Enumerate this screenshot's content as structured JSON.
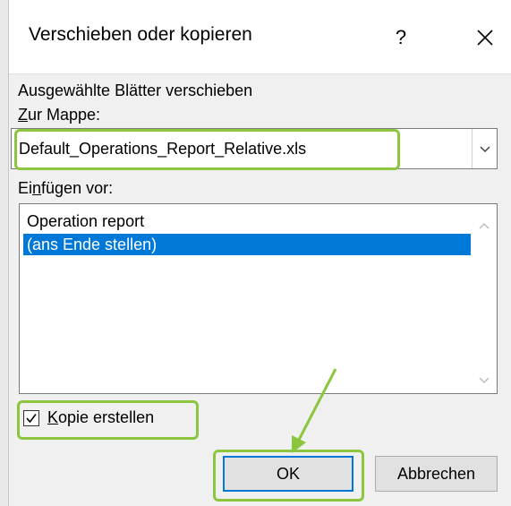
{
  "dialog": {
    "title": "Verschieben oder kopieren",
    "help_label": "?",
    "close_icon": "close-icon"
  },
  "move_section": {
    "heading": "Ausgewählte Blätter verschieben",
    "to_book_label_underlined": "Z",
    "to_book_label_rest": "ur Mappe:",
    "combo_value": "Default_Operations_Report_Relative.xls"
  },
  "insert_before": {
    "label_pre": "Ei",
    "label_underlined": "n",
    "label_post": "fügen vor:",
    "items": [
      {
        "label": "Operation report",
        "selected": false
      },
      {
        "label": "(ans Ende stellen)",
        "selected": true
      }
    ]
  },
  "copy_option": {
    "checked": true,
    "label_underlined": "K",
    "label_rest": "opie erstellen"
  },
  "buttons": {
    "ok_label": "OK",
    "cancel_label": "Abbrechen"
  },
  "colors": {
    "highlight": "#8cc63e",
    "selection": "#0078d7",
    "dialog_bg": "#f0f0f0"
  }
}
